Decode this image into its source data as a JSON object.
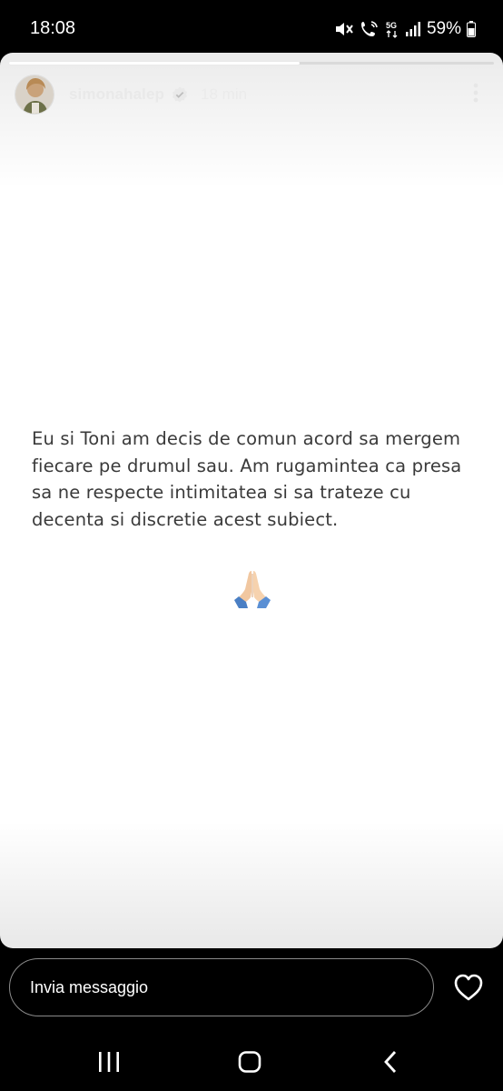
{
  "status_bar": {
    "time": "18:08",
    "network": "5G",
    "battery": "59%",
    "icons": [
      "mute-icon",
      "wifi-call-icon",
      "5g-icon",
      "signal-icon",
      "battery-icon"
    ]
  },
  "story": {
    "progress_fraction": 0.6,
    "username": "simonahalep",
    "verified": true,
    "time_ago": "18 min",
    "text": "Eu si Toni am decis de comun acord sa mergem fiecare pe drumul sau. Am rugamintea ca presa sa ne respecte intimitatea si sa trateze cu decenta si discretie acest subiect.",
    "emoji": "folded-hands"
  },
  "reply": {
    "placeholder": "Invia messaggio"
  },
  "nav": {
    "icons": [
      "recent-apps-icon",
      "home-icon",
      "back-icon"
    ]
  },
  "colors": {
    "background": "#000000",
    "story_background": "#ffffff",
    "story_text": "#3a3a3a",
    "username": "#e9e9e9"
  }
}
